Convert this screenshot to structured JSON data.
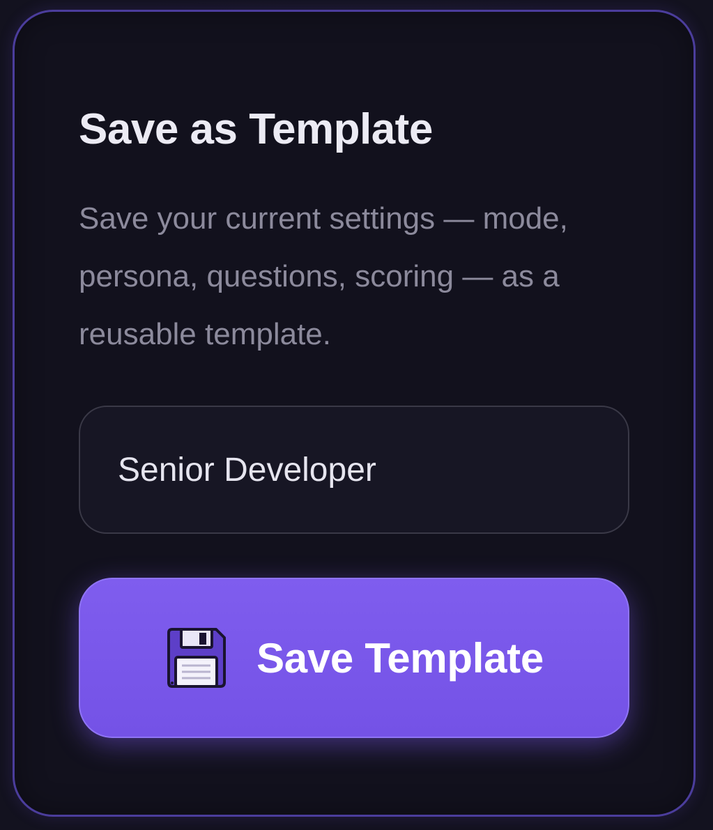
{
  "panel": {
    "title": "Save as Template",
    "description": "Save your current settings — mode, persona, questions, scoring — as a reusable template.",
    "name_input": {
      "value": "Senior Developer"
    },
    "save_button": {
      "label": "Save Template",
      "icon": "floppy-disk-icon"
    }
  },
  "colors": {
    "background": "#13121f",
    "card_border": "#4b3d9c",
    "accent": "#7452e6",
    "title_text": "#ecebf4",
    "muted_text": "#8c8a9c"
  }
}
